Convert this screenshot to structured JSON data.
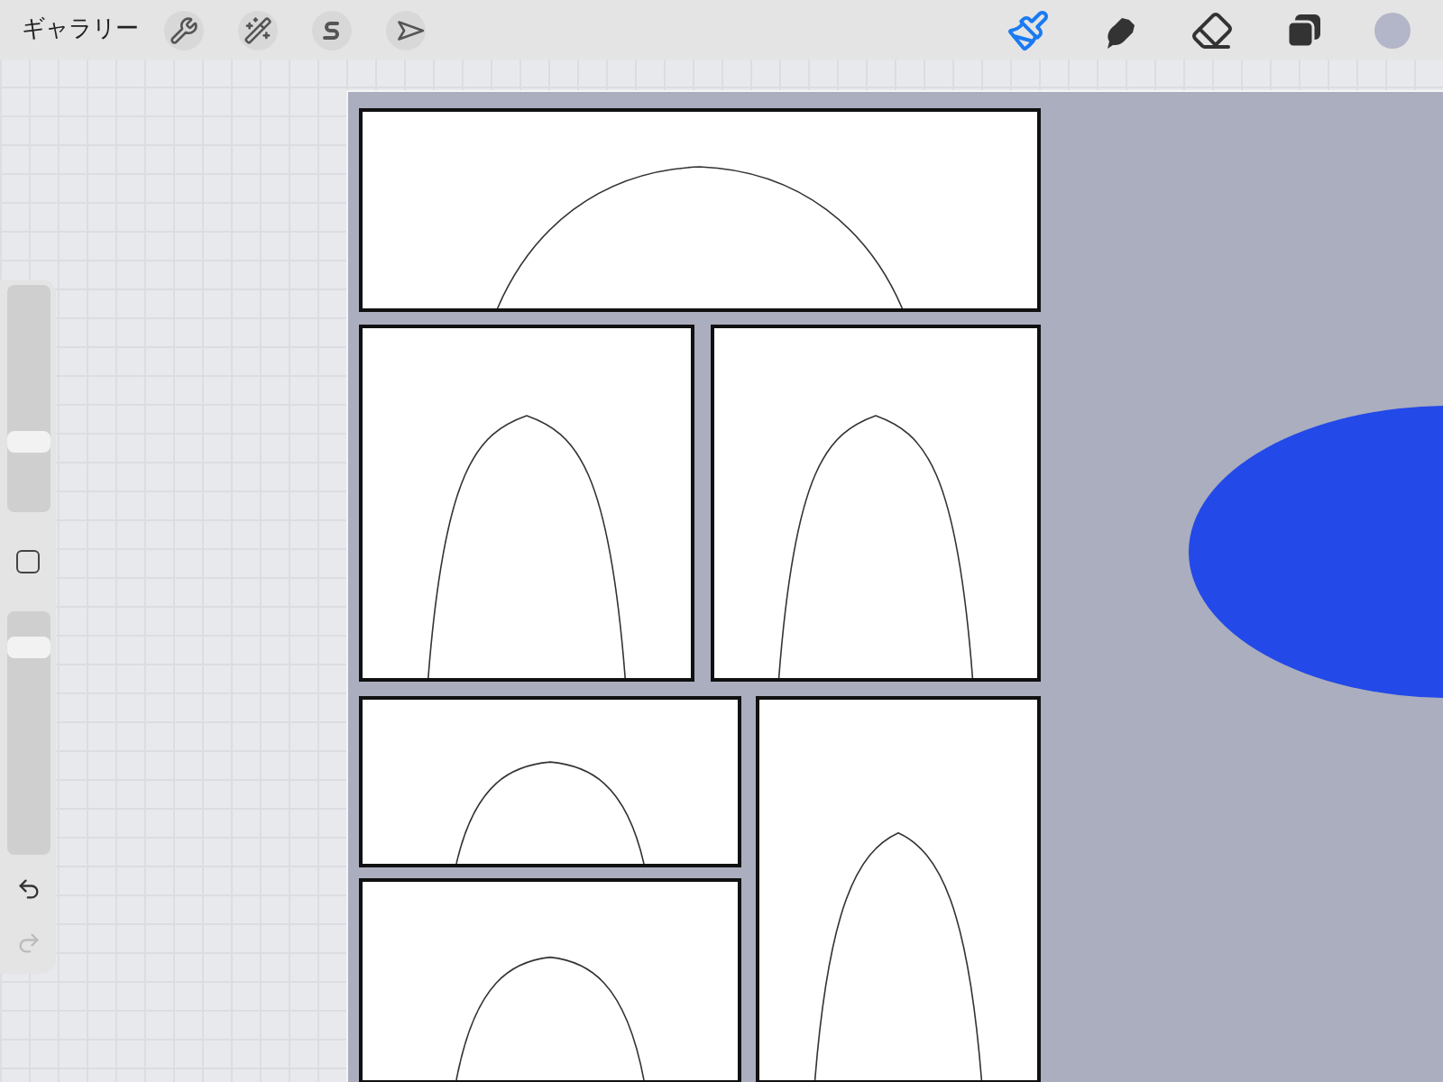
{
  "toolbar": {
    "gallery": "ギャラリー",
    "actions": [
      {
        "kind": "wrench"
      },
      {
        "kind": "wand"
      },
      {
        "kind": "selection"
      },
      {
        "kind": "transform"
      }
    ],
    "tools": [
      {
        "kind": "brush",
        "selected": true
      },
      {
        "kind": "smudge",
        "selected": false
      },
      {
        "kind": "eraser",
        "selected": false
      },
      {
        "kind": "layers",
        "selected": false
      }
    ],
    "color": "#b3b5c8"
  },
  "sidebar": {
    "size_slider": {
      "level": 0.29
    },
    "opacity_slider": {
      "level": 0.89
    },
    "undo": {
      "disabled": false
    },
    "redo": {
      "disabled": true
    }
  },
  "canvas": {
    "panels": [
      {
        "kind": "wide"
      },
      {
        "kind": "portrait"
      },
      {
        "kind": "portrait"
      },
      {
        "kind": "small"
      },
      {
        "kind": "tall"
      },
      {
        "kind": "small"
      }
    ],
    "shape": {
      "kind": "ellipse",
      "color": "#2349e8"
    }
  }
}
